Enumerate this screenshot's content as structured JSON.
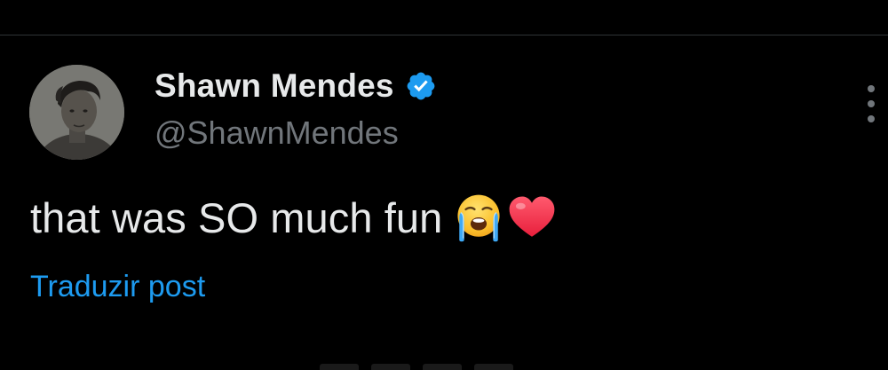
{
  "colors": {
    "background": "#000000",
    "text_primary": "#e7e9ea",
    "text_secondary": "#71767b",
    "link": "#1d9bf0",
    "verified": "#1d9bf0",
    "divider": "#2f3336"
  },
  "post": {
    "author": {
      "name": "Shawn Mendes",
      "handle": "@ShawnMendes",
      "verified": true,
      "avatar_icon": "avatar-photo",
      "badge_icon": "verified-badge-icon"
    },
    "text": "that was SO much fun",
    "emojis": [
      "loudly-crying-face-emoji",
      "red-heart-emoji"
    ],
    "translate_label": "Traduzir post",
    "more_icon": "more-options-icon"
  }
}
